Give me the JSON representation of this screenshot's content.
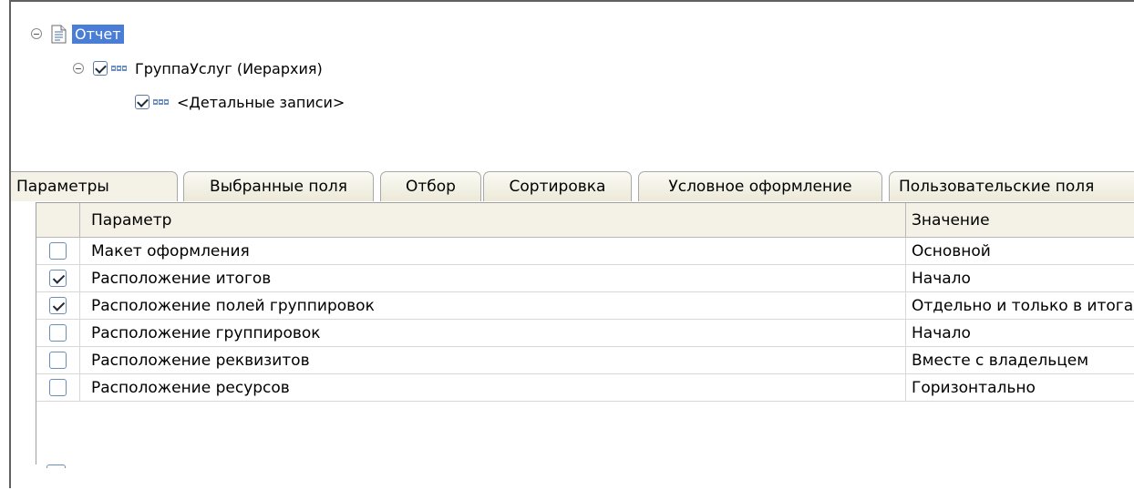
{
  "tree": {
    "root_label": "Отчет",
    "group_label": "ГруппаУслуг (Иерархия)",
    "group_checked": true,
    "detail_label": "<Детальные записи>",
    "detail_checked": true
  },
  "tabs": [
    {
      "label": "Параметры",
      "active": true
    },
    {
      "label": "Выбранные поля"
    },
    {
      "label": "Отбор"
    },
    {
      "label": "Сортировка"
    },
    {
      "label": "Условное оформление"
    },
    {
      "label": "Пользовательские поля"
    }
  ],
  "table": {
    "headers": {
      "param": "Параметр",
      "value": "Значение"
    },
    "rows": [
      {
        "checked": false,
        "param": "Макет оформления",
        "value": "Основной"
      },
      {
        "checked": true,
        "param": "Расположение итогов",
        "value": "Начало"
      },
      {
        "checked": true,
        "param": "Расположение полей группировок",
        "value": "Отдельно и только в итогах"
      },
      {
        "checked": false,
        "param": "Расположение группировок",
        "value": "Начало"
      },
      {
        "checked": false,
        "param": "Расположение реквизитов",
        "value": "Вместе с владельцем"
      },
      {
        "checked": false,
        "param": "Расположение ресурсов",
        "value": "Горизонтально"
      }
    ]
  }
}
